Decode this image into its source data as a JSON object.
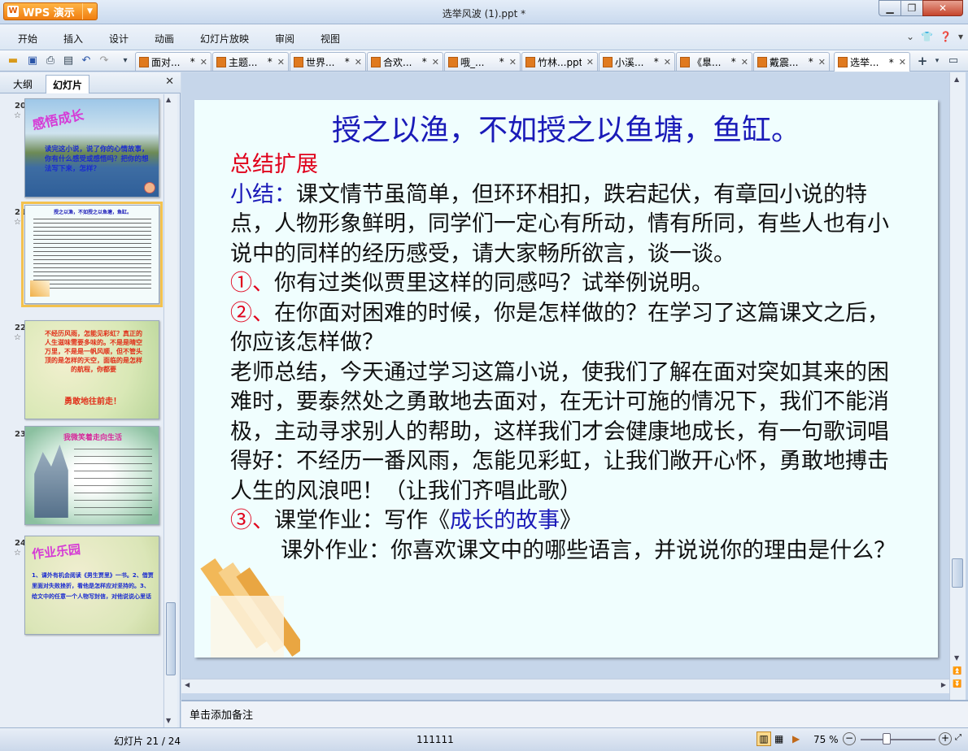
{
  "app": {
    "name": "WPS 演示",
    "window_title": "选举风波 (1).ppt *"
  },
  "menu": [
    "开始",
    "插入",
    "设计",
    "动画",
    "幻灯片放映",
    "审阅",
    "视图"
  ],
  "tabs": [
    {
      "label": "面对...",
      "modified": "*"
    },
    {
      "label": "主题...",
      "modified": "*"
    },
    {
      "label": "世界...",
      "modified": "*"
    },
    {
      "label": "合欢...",
      "modified": "*"
    },
    {
      "label": "哦_...",
      "modified": "*"
    },
    {
      "label": "竹林...ppt",
      "modified": ""
    },
    {
      "label": "小溪...",
      "modified": "*"
    },
    {
      "label": "《臯...",
      "modified": "*"
    },
    {
      "label": "戴震...",
      "modified": "*"
    },
    {
      "label": "选举...",
      "modified": "*"
    }
  ],
  "left_panel": {
    "tab_outline": "大纲",
    "tab_slides": "幻灯片"
  },
  "thumbnails": [
    {
      "num": "20",
      "title": "感悟成长",
      "text": "读完这小说，说了你的心情故事，你有什么感受或感悟吗？把你的想法写下来，怎样？"
    },
    {
      "num": "21",
      "title": "授之以渔，不如授之以鱼塘，鱼缸。",
      "text": ""
    },
    {
      "num": "22",
      "title": "",
      "text": "不经历风雨，怎能见彩虹？真正的人生滋味需要多味的。不是是晴空万里，不是是一帆风顺，但不管头顶的是怎样的天空，面临的是怎样的航程，你都要",
      "footer": "勇敢地往前走！"
    },
    {
      "num": "23",
      "title": "我微笑着走向生活",
      "text": ""
    },
    {
      "num": "24",
      "title": "作业乐园",
      "text": "1、课外有机会阅读《男生贾里》一书。2、借贾里面对失败挫折，看他是怎样应对坚持的。3、给文中的任意一个人物写封信，对他说说心里话"
    }
  ],
  "slide": {
    "title": "授之以渔，不如授之以鱼塘，鱼缸。",
    "heading": "总结扩展",
    "summary_label": "小结：",
    "summary_text": "课文情节虽简单，但环环相扣，跌宕起伏，有章回小说的特点，人物形象鲜明，同学们一定心有所动，情有所同，有些人也有小说中的同样的经历感受，请大家畅所欲言，谈一谈。",
    "q1_mark": "①、",
    "q1_text": "你有过类似贾里这样的同感吗？试举例说明。",
    "q2_mark": "②、",
    "q2_text": "在你面对困难的时候，你是怎样做的？在学习了这篇课文之后，你应该怎样做？",
    "teacher_summary": "老师总结，今天通过学习这篇小说，使我们了解在面对突如其来的困难时，要泰然处之勇敢地去面对，在无计可施的情况下，我们不能消极，主动寻求别人的帮助，这样我们才会健康地成长，有一句歌词唱得好：不经历一番风雨，怎能见彩虹，让我们敞开心怀，勇敢地搏击人生的风浪吧！（让我们齐唱此歌）",
    "q3_mark": "③、",
    "homework_prefix": "课堂作业：写作《",
    "homework_title": "成长的故事",
    "homework_suffix": "》",
    "extra_homework": "课外作业：你喜欢课文中的哪些语言，并说说你的理由是什么？"
  },
  "notes_placeholder": "单击添加备注",
  "status": {
    "slide_info": "幻灯片 21 / 24",
    "template": "111111",
    "zoom": "75 %"
  }
}
